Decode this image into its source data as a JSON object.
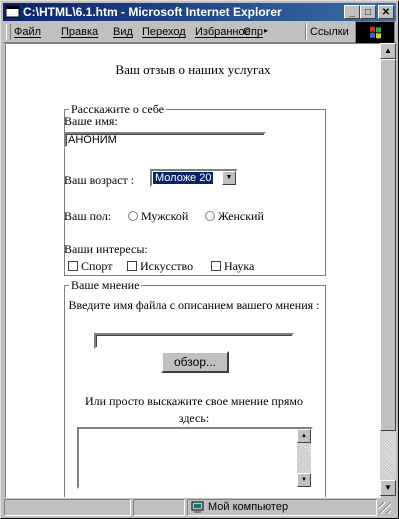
{
  "window": {
    "title": "C:\\HTML\\6.1.htm - Microsoft Internet Explorer",
    "minimize": "_",
    "maximize": "□",
    "close": "✕"
  },
  "menu": {
    "items": [
      "Файл",
      "Правка",
      "Вид",
      "Переход",
      "Избранное",
      "Справ"
    ],
    "more": "▸",
    "links": "Ссылки"
  },
  "page": {
    "heading": "Ваш отзыв о наших услугах",
    "about": {
      "legend": "Расскажите о себе",
      "name_label": "Ваше имя:",
      "name_value": "АНОНИМ",
      "age_label": "Ваш возраст :",
      "age_value": "Моложе 20",
      "gender_label": "Ваш пол:",
      "gender_male": "Мужской",
      "gender_female": "Женский",
      "interests_label": "Ваши интересы:",
      "interest_sport": "Спорт",
      "interest_art": "Искусство",
      "interest_science": "Наука"
    },
    "opinion": {
      "legend": "Ваше мнение",
      "file_prompt": "Введите имя файла с описанием вашего мнения :",
      "browse_button": "обзор...",
      "text_prompt": "Или просто выскажите свое мнение прямо здесь:"
    }
  },
  "status": {
    "zone": "Мой компьютер"
  }
}
